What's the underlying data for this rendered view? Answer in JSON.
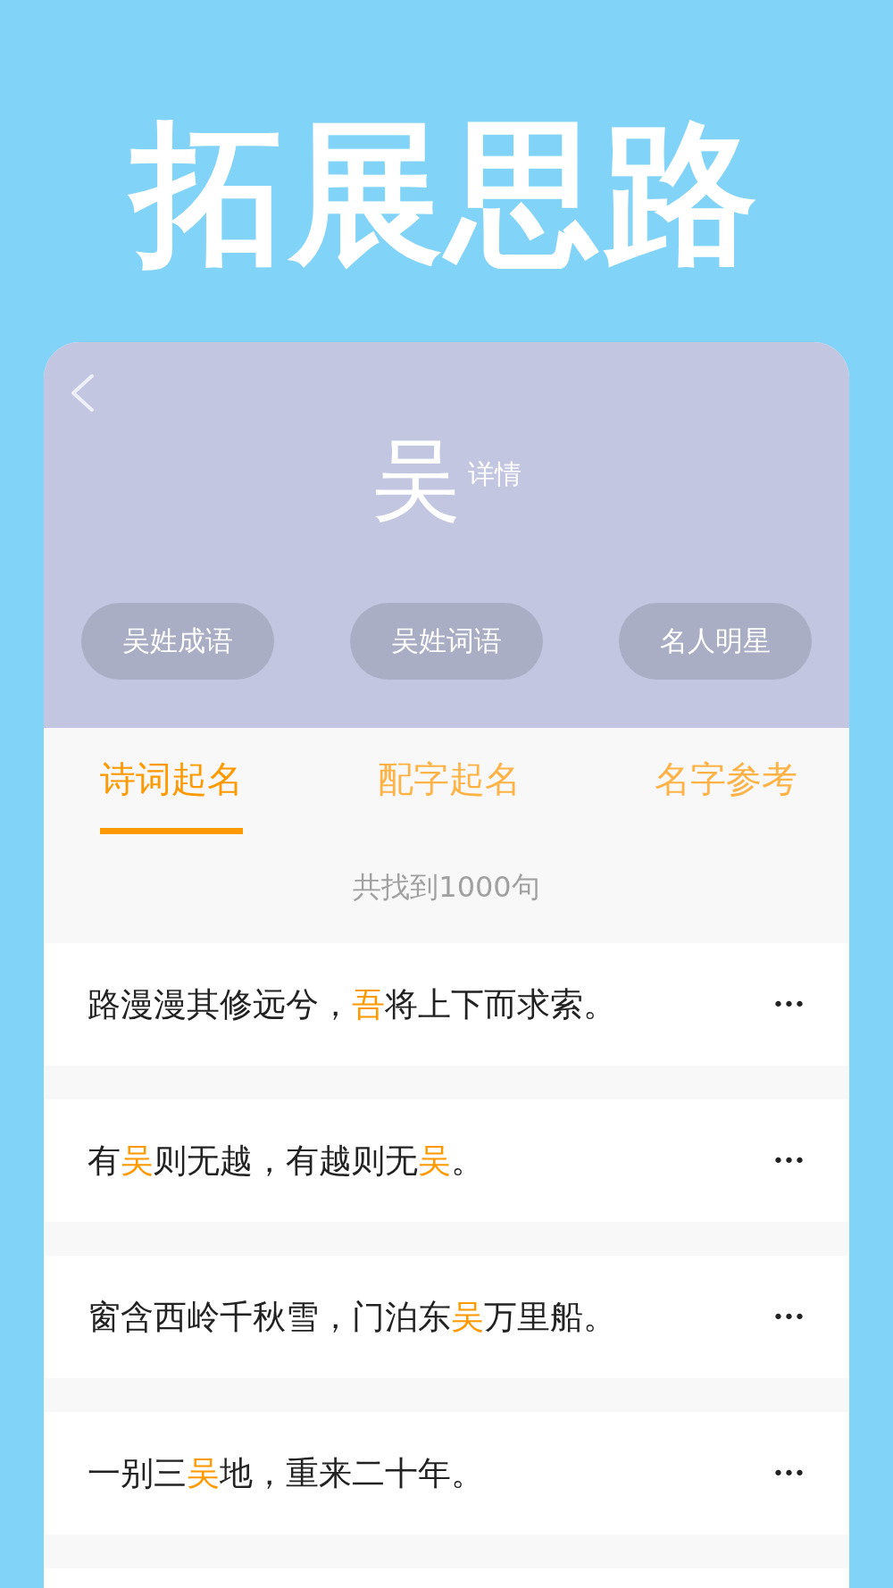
{
  "headline": "拓展思路",
  "header": {
    "character": "吴",
    "detail_label": "详情"
  },
  "pills": [
    "吴姓成语",
    "吴姓词语",
    "名人明星"
  ],
  "tabs": [
    {
      "label": "诗词起名",
      "selected": true
    },
    {
      "label": "配字起名",
      "selected": false
    },
    {
      "label": "名字参考",
      "selected": false
    }
  ],
  "result_count": "共找到1000句",
  "verses": [
    {
      "parts": [
        {
          "text": "路漫漫其修远兮，",
          "highlight": false
        },
        {
          "text": "吾",
          "highlight": true
        },
        {
          "text": "将上下而求索。",
          "highlight": false
        }
      ],
      "more": "•••"
    },
    {
      "parts": [
        {
          "text": "有",
          "highlight": false
        },
        {
          "text": "吴",
          "highlight": true
        },
        {
          "text": "则无越，有越则无",
          "highlight": false
        },
        {
          "text": "吴",
          "highlight": true
        },
        {
          "text": "。",
          "highlight": false
        }
      ],
      "more": "•••"
    },
    {
      "parts": [
        {
          "text": "窗含西岭千秋雪，门泊东",
          "highlight": false
        },
        {
          "text": "吴",
          "highlight": true
        },
        {
          "text": "万里船。",
          "highlight": false
        }
      ],
      "more": "•••"
    },
    {
      "parts": [
        {
          "text": "一别三",
          "highlight": false
        },
        {
          "text": "吴",
          "highlight": true
        },
        {
          "text": "地，重来二十年。",
          "highlight": false
        }
      ],
      "more": "•••"
    }
  ]
}
